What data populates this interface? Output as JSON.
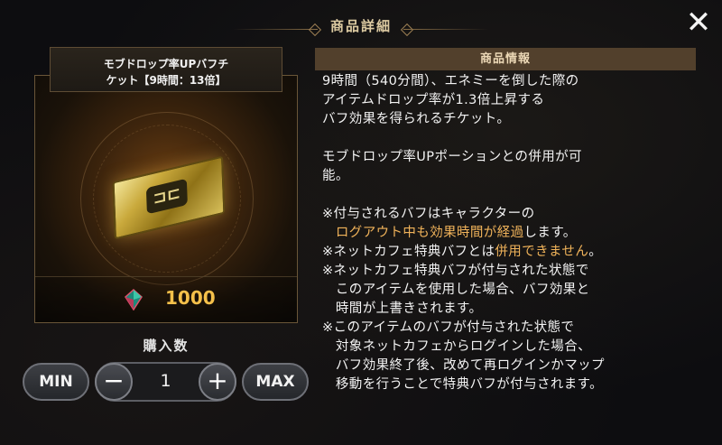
{
  "header": {
    "title": "商品詳細"
  },
  "icons": {
    "close": "close-icon",
    "currency": "crystal-gem-icon",
    "item": "gold-ticket-icon"
  },
  "colors": {
    "accent": "#f5c04a",
    "highlight": "#f0b35a",
    "panel_header": "#52402c"
  },
  "item": {
    "name_line1": "モブドロップ率UPバフチ",
    "name_line2": "ケット【9時間：13倍】",
    "price": "1000"
  },
  "purchase": {
    "label": "購入数",
    "min_label": "MIN",
    "max_label": "MAX",
    "quantity": "1",
    "minus": "−",
    "plus": "+"
  },
  "info": {
    "header": "商品情報",
    "p1_l1": "9時間（540分間）、エネミーを倒した際の",
    "p1_l2": "アイテムドロップ率が1.3倍上昇する",
    "p1_l3": "バフ効果を得られるチケット。",
    "p2_l1": "モブドロップ率UPポーションとの併用が可",
    "p2_l2": "能。",
    "n1_l1": "※付与されるバフはキャラクターの",
    "n1_l2_hl": "ログアウト中も効果時間が経過",
    "n1_l2_rest": "します。",
    "n2_pre": "※ネットカフェ特典バフとは",
    "n2_hl": "併用できません",
    "n2_post": "。",
    "n3_l1": "※ネットカフェ特典バフが付与された状態で",
    "n3_l2": "このアイテムを使用した場合、バフ効果と",
    "n3_l3": "時間が上書きされます。",
    "n4_l1": "※このアイテムのバフが付与された状態で",
    "n4_l2": "対象ネットカフェからログインした場合、",
    "n4_l3": "バフ効果終了後、改めて再ログインかマップ",
    "n4_l4": "移動を行うことで特典バフが付与されます。"
  }
}
